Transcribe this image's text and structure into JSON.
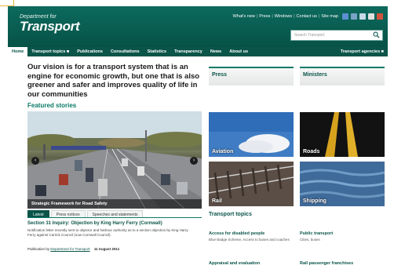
{
  "header": {
    "logo_small": "Department for",
    "logo_big": "Transport",
    "util_links": [
      "What's new",
      "Press",
      "Windows",
      "Contact us",
      "Site map"
    ],
    "search_placeholder": "Search Transport",
    "social_colors": [
      "#5b8fd1",
      "#7aa3c8",
      "#c7d9e8",
      "#e0e0e0",
      "#d1523e"
    ]
  },
  "nav": {
    "items": [
      "Home",
      "Transport topics",
      "Publications",
      "Consultations",
      "Statistics",
      "Transparency",
      "News",
      "About us"
    ],
    "right": "Transport agencies"
  },
  "vision": "Our vision is for a transport system that is an engine for economic growth, but one that is also greener and safer and improves quality of life in our communities",
  "featured": {
    "title": "Featured stories",
    "caption": "Strategic Framework for Road Safety",
    "tabs": [
      "Latest",
      "Press notices",
      "Speeches and statements"
    ],
    "story_title": "Section 31 Inquiry: Objection by King Harry Ferry (Cornwall)",
    "story_body": "Notification letter recently sent to objector and harbour authority as to a section objection by King Harry Ferry against Carrick Council (now Cornwall Council).",
    "story_meta_label": "Publication by",
    "story_meta_link": "Department for Transport",
    "story_meta_date": "11 August 2011"
  },
  "panels": {
    "press": "Press",
    "ministers": "Ministers"
  },
  "tiles": {
    "aviation": "Aviation",
    "roads": "Roads",
    "rail": "Rail",
    "shipping": "Shipping"
  },
  "topics": {
    "title": "Transport topics",
    "items": [
      {
        "link": "Access for disabled people",
        "desc": "Blue Badge Scheme, Access to buses and coaches"
      },
      {
        "link": "Public transport",
        "desc": "Cities, buses"
      },
      {
        "link": "Appraisal and evaluation",
        "desc": ""
      },
      {
        "link": "Rail passenger franchises",
        "desc": ""
      }
    ]
  },
  "colors": {
    "brand": "#0a5449",
    "accent": "#0a7a67",
    "highlight": "#e8b339"
  }
}
